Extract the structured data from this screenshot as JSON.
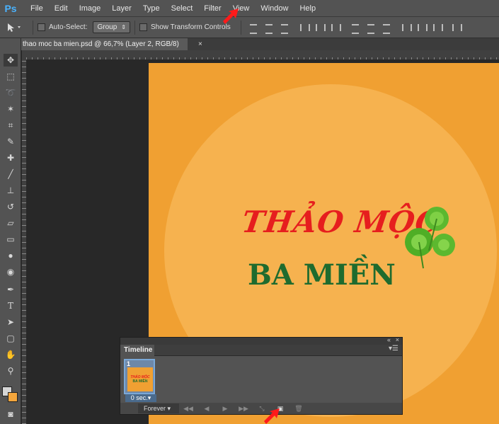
{
  "app": {
    "logo": "Ps"
  },
  "menu": [
    "File",
    "Edit",
    "Image",
    "Layer",
    "Type",
    "Select",
    "Filter",
    "View",
    "Window",
    "Help"
  ],
  "options": {
    "auto_select_label": "Auto-Select:",
    "auto_select_value": "Group",
    "transform_label": "Show Transform Controls"
  },
  "document": {
    "tab_title": "thao moc ba mien.psd @ 66,7% (Layer 2, RGB/8)",
    "close": "×"
  },
  "canvas": {
    "line1": "THẢO MỘC",
    "line2": "BA MIỀN"
  },
  "timeline": {
    "title": "Timeline",
    "frame_number": "1",
    "thumb_line1": "THẢO MỘC",
    "thumb_line2": "BA MIỀN",
    "frame_delay": "0 sec.▾",
    "loop_value": "Forever ▾"
  },
  "colors": {
    "fg": "#d6d6d6",
    "bg": "#f4a63c",
    "canvas": "#f0a032",
    "title_red": "#e61e1e",
    "title_green": "#1f6b2e"
  }
}
